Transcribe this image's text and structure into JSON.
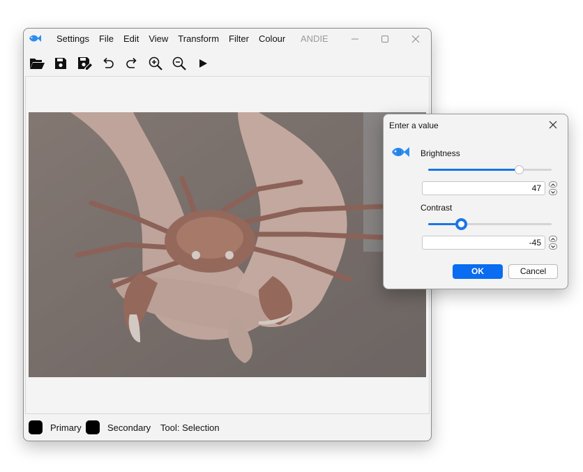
{
  "app": {
    "title": "ANDIE",
    "menu": [
      "Settings",
      "File",
      "Edit",
      "View",
      "Transform",
      "Filter",
      "Colour"
    ]
  },
  "toolbar": {
    "icons": [
      "open-folder-icon",
      "save-icon",
      "save-as-icon",
      "undo-icon",
      "redo-icon",
      "zoom-in-icon",
      "zoom-out-icon",
      "play-icon"
    ]
  },
  "status": {
    "primary_label": "Primary",
    "secondary_label": "Secondary",
    "tool_text": "Tool: Selection",
    "primary_color": "#000000",
    "secondary_color": "#000000"
  },
  "dialog": {
    "title": "Enter a value",
    "brightness": {
      "label": "Brightness",
      "value": "47",
      "slider_fraction": 0.74
    },
    "contrast": {
      "label": "Contrast",
      "value": "-45",
      "slider_fraction": 0.27
    },
    "ok_label": "OK",
    "cancel_label": "Cancel"
  },
  "colors": {
    "accent": "#0a6cf0",
    "slider_fill": "#1976e8"
  }
}
